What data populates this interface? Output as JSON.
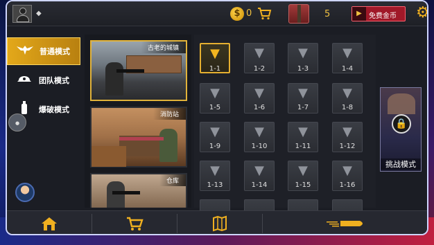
{
  "topbar": {
    "coins": "0",
    "crates": "5",
    "free_coins_label": "免费金币"
  },
  "modes": [
    {
      "label": "普通模式",
      "icon": "eagle-icon",
      "active": true
    },
    {
      "label": "团队模式",
      "icon": "team-helmet-icon",
      "active": false
    },
    {
      "label": "爆破模式",
      "icon": "bomb-icon",
      "active": false
    }
  ],
  "maps": [
    {
      "title": "古老的城镇",
      "active": true
    },
    {
      "title": "消防站",
      "active": false
    },
    {
      "title": "仓库",
      "active": false
    }
  ],
  "levels": [
    {
      "label": "1-1",
      "active": true
    },
    {
      "label": "1-2"
    },
    {
      "label": "1-3"
    },
    {
      "label": "1-4"
    },
    {
      "label": "1-5"
    },
    {
      "label": "1-6"
    },
    {
      "label": "1-7"
    },
    {
      "label": "1-8"
    },
    {
      "label": "1-9"
    },
    {
      "label": "1-10"
    },
    {
      "label": "1-11"
    },
    {
      "label": "1-12"
    },
    {
      "label": "1-13"
    },
    {
      "label": "1-14"
    },
    {
      "label": "1-15"
    },
    {
      "label": "1-16"
    }
  ],
  "challenge": {
    "title": "挑战模式"
  },
  "bottom_nav": [
    {
      "icon": "home-icon"
    },
    {
      "icon": "cart-icon"
    },
    {
      "icon": "map-icon"
    },
    {
      "icon": "bullet-icon"
    }
  ],
  "colors": {
    "accent_gold": "#e6b030",
    "frame_border": "#cfd6ff",
    "free_button_red": "#a01828"
  }
}
